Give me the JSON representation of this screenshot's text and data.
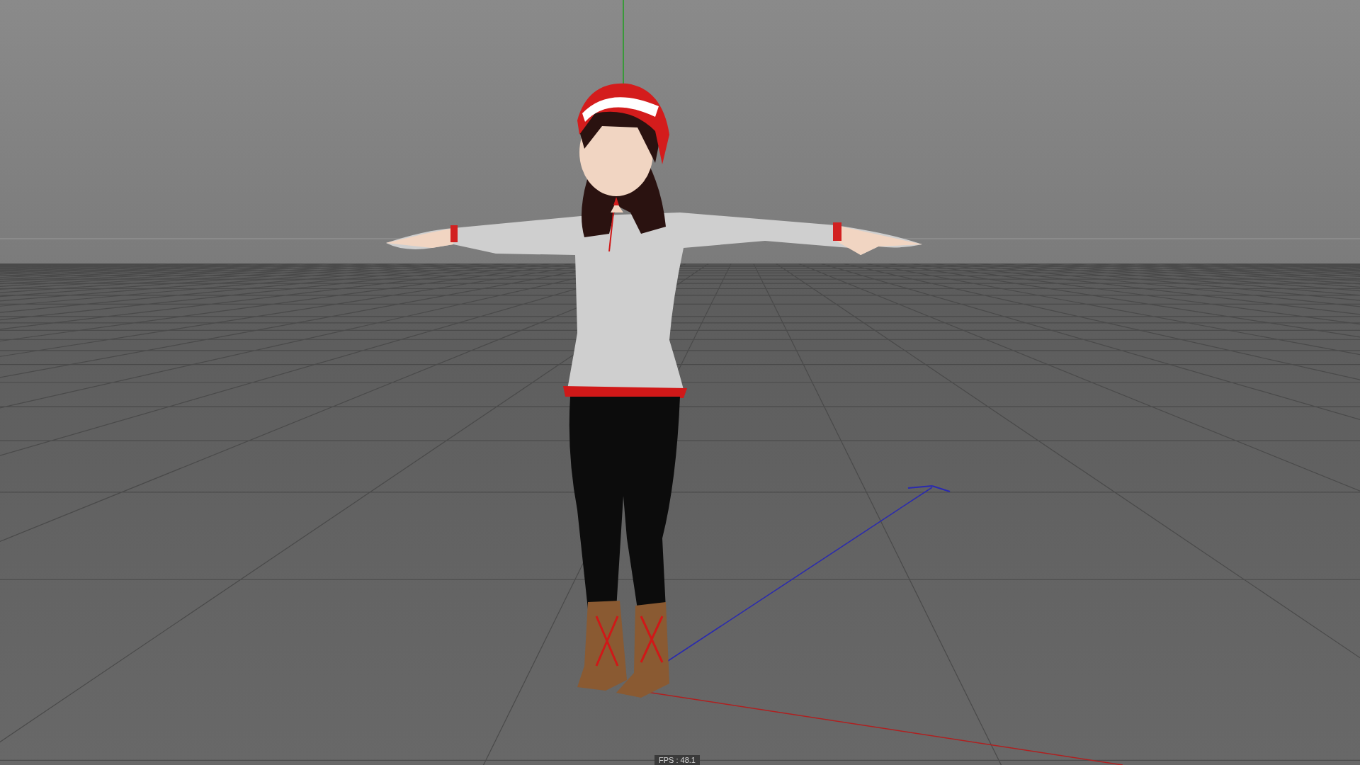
{
  "viewport": {
    "fps_label": "FPS : 48.1"
  }
}
